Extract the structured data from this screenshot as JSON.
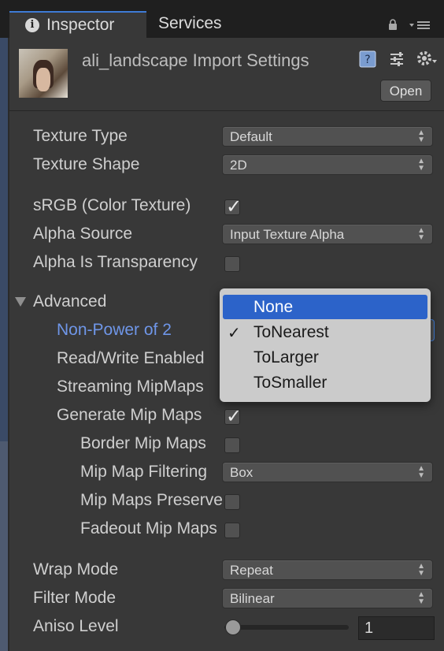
{
  "tabs": [
    {
      "label": "Inspector",
      "icon": "info-icon"
    },
    {
      "label": "Services"
    }
  ],
  "header": {
    "title": "ali_landscape Import Settings",
    "open_label": "Open"
  },
  "fields": {
    "texture_type": {
      "label": "Texture Type",
      "value": "Default"
    },
    "texture_shape": {
      "label": "Texture Shape",
      "value": "2D"
    },
    "srgb": {
      "label": "sRGB (Color Texture)",
      "checked": true
    },
    "alpha_source": {
      "label": "Alpha Source",
      "value": "Input Texture Alpha"
    },
    "alpha_transparency": {
      "label": "Alpha Is Transparency",
      "checked": false
    },
    "advanced": {
      "label": "Advanced"
    },
    "npot": {
      "label": "Non-Power of 2"
    },
    "read_write": {
      "label": "Read/Write Enabled"
    },
    "streaming_mip": {
      "label": "Streaming MipMaps"
    },
    "generate_mip": {
      "label": "Generate Mip Maps",
      "checked": true
    },
    "border_mip": {
      "label": "Border Mip Maps",
      "checked": false
    },
    "mip_filtering": {
      "label": "Mip Map Filtering",
      "value": "Box"
    },
    "mip_preserve": {
      "label": "Mip Maps Preserve Coverage",
      "checked": false
    },
    "fadeout_mip": {
      "label": "Fadeout Mip Maps",
      "checked": false
    },
    "wrap_mode": {
      "label": "Wrap Mode",
      "value": "Repeat"
    },
    "filter_mode": {
      "label": "Filter Mode",
      "value": "Bilinear"
    },
    "aniso_level": {
      "label": "Aniso Level",
      "value": "1",
      "slider_fraction": 0.0
    }
  },
  "npot_menu": {
    "options": [
      "None",
      "ToNearest",
      "ToLarger",
      "ToSmaller"
    ],
    "highlighted": "None",
    "selected": "ToNearest"
  },
  "colors": {
    "accent": "#3e7bd6",
    "highlight": "#2c63c9",
    "link_label": "#6f96e8"
  }
}
